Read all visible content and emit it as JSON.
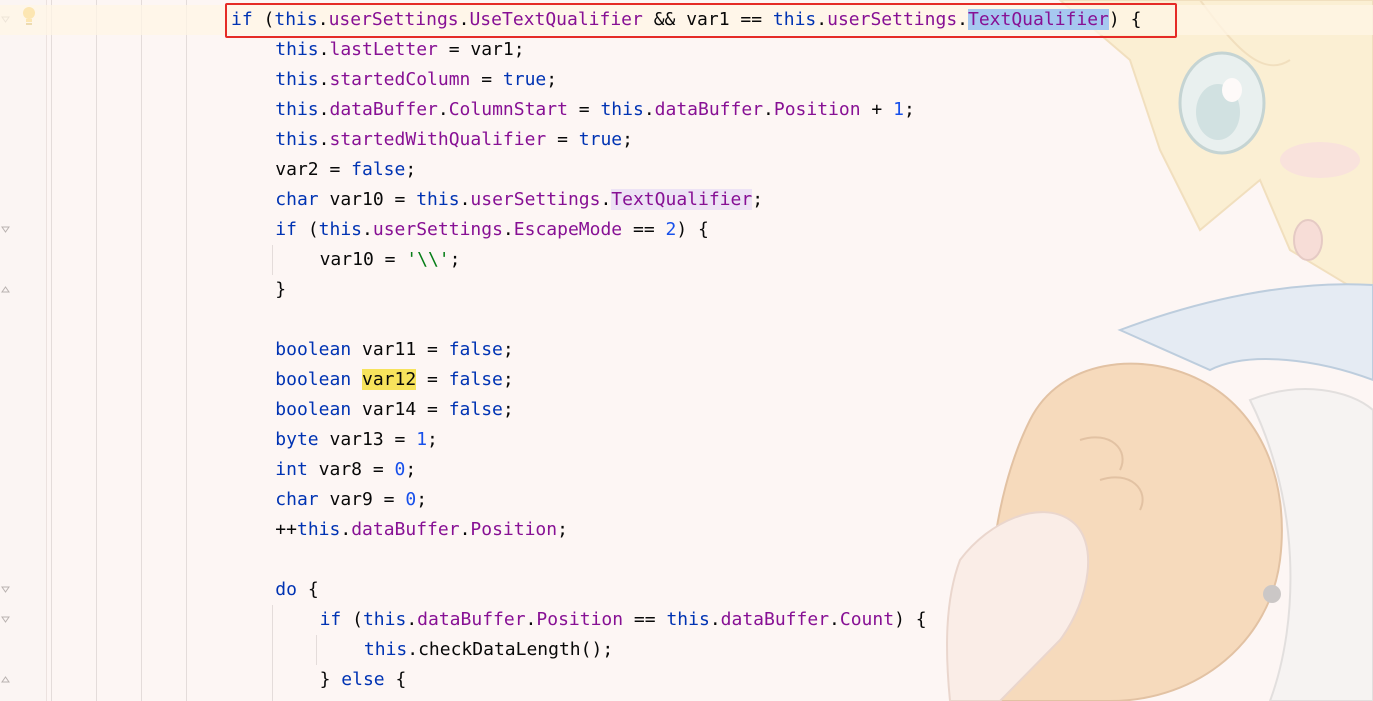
{
  "editor": {
    "accent_colors": {
      "keyword": "#0033b3",
      "field": "#871094",
      "number": "#1750eb",
      "string": "#067d17",
      "highlight_box": "#e52b26",
      "selection": "#a6c8f0",
      "identifier_highlight": "#f7e35c"
    },
    "gutter_icons": [
      "intention-bulb-icon",
      "fold-icon"
    ],
    "background_image": "anime-character-background"
  },
  "code_lines": [
    {
      "indent": 0,
      "tokens": [
        {
          "t": "if",
          "c": "kw"
        },
        {
          "t": " ("
        },
        {
          "t": "this",
          "c": "kw"
        },
        {
          "t": "."
        },
        {
          "t": "userSettings",
          "c": "fld"
        },
        {
          "t": "."
        },
        {
          "t": "UseTextQualifier",
          "c": "fld"
        },
        {
          "t": " && var1 == "
        },
        {
          "t": "this",
          "c": "kw"
        },
        {
          "t": "."
        },
        {
          "t": "userSettings",
          "c": "fld"
        },
        {
          "t": "."
        },
        {
          "t": "TextQualifier",
          "c": "fld sel-hl"
        },
        {
          "t": ") {"
        }
      ]
    },
    {
      "indent": 1,
      "tokens": [
        {
          "t": "this",
          "c": "kw"
        },
        {
          "t": "."
        },
        {
          "t": "lastLetter",
          "c": "fld"
        },
        {
          "t": " = var1;"
        }
      ]
    },
    {
      "indent": 1,
      "tokens": [
        {
          "t": "this",
          "c": "kw"
        },
        {
          "t": "."
        },
        {
          "t": "startedColumn",
          "c": "fld"
        },
        {
          "t": " = "
        },
        {
          "t": "true",
          "c": "kw"
        },
        {
          "t": ";"
        }
      ]
    },
    {
      "indent": 1,
      "tokens": [
        {
          "t": "this",
          "c": "kw"
        },
        {
          "t": "."
        },
        {
          "t": "dataBuffer",
          "c": "fld"
        },
        {
          "t": "."
        },
        {
          "t": "ColumnStart",
          "c": "fld"
        },
        {
          "t": " = "
        },
        {
          "t": "this",
          "c": "kw"
        },
        {
          "t": "."
        },
        {
          "t": "dataBuffer",
          "c": "fld"
        },
        {
          "t": "."
        },
        {
          "t": "Position",
          "c": "fld"
        },
        {
          "t": " + "
        },
        {
          "t": "1",
          "c": "num"
        },
        {
          "t": ";"
        }
      ]
    },
    {
      "indent": 1,
      "tokens": [
        {
          "t": "this",
          "c": "kw"
        },
        {
          "t": "."
        },
        {
          "t": "startedWithQualifier",
          "c": "fld"
        },
        {
          "t": " = "
        },
        {
          "t": "true",
          "c": "kw"
        },
        {
          "t": ";"
        }
      ]
    },
    {
      "indent": 1,
      "tokens": [
        {
          "t": "var2 = "
        },
        {
          "t": "false",
          "c": "kw"
        },
        {
          "t": ";"
        }
      ]
    },
    {
      "indent": 1,
      "tokens": [
        {
          "t": "char",
          "c": "kw"
        },
        {
          "t": " var10 = "
        },
        {
          "t": "this",
          "c": "kw"
        },
        {
          "t": "."
        },
        {
          "t": "userSettings",
          "c": "fld"
        },
        {
          "t": "."
        },
        {
          "t": "TextQualifier",
          "c": "fld ident-hl"
        },
        {
          "t": ";"
        }
      ]
    },
    {
      "indent": 1,
      "tokens": [
        {
          "t": "if",
          "c": "kw"
        },
        {
          "t": " ("
        },
        {
          "t": "this",
          "c": "kw"
        },
        {
          "t": "."
        },
        {
          "t": "userSettings",
          "c": "fld"
        },
        {
          "t": "."
        },
        {
          "t": "EscapeMode",
          "c": "fld"
        },
        {
          "t": " == "
        },
        {
          "t": "2",
          "c": "num"
        },
        {
          "t": ") {"
        }
      ]
    },
    {
      "indent": 2,
      "tokens": [
        {
          "t": "var10 = "
        },
        {
          "t": "'\\\\'",
          "c": "str"
        },
        {
          "t": ";"
        }
      ]
    },
    {
      "indent": 1,
      "tokens": [
        {
          "t": "}"
        }
      ]
    },
    {
      "indent": 0,
      "tokens": []
    },
    {
      "indent": 1,
      "tokens": [
        {
          "t": "boolean",
          "c": "kw"
        },
        {
          "t": " var11 = "
        },
        {
          "t": "false",
          "c": "kw"
        },
        {
          "t": ";"
        }
      ]
    },
    {
      "indent": 1,
      "tokens": [
        {
          "t": "boolean",
          "c": "kw"
        },
        {
          "t": " "
        },
        {
          "t": "var12",
          "c": "var-hl"
        },
        {
          "t": " = "
        },
        {
          "t": "false",
          "c": "kw"
        },
        {
          "t": ";"
        }
      ]
    },
    {
      "indent": 1,
      "tokens": [
        {
          "t": "boolean",
          "c": "kw"
        },
        {
          "t": " var14 = "
        },
        {
          "t": "false",
          "c": "kw"
        },
        {
          "t": ";"
        }
      ]
    },
    {
      "indent": 1,
      "tokens": [
        {
          "t": "byte",
          "c": "kw"
        },
        {
          "t": " var13 = "
        },
        {
          "t": "1",
          "c": "num"
        },
        {
          "t": ";"
        }
      ]
    },
    {
      "indent": 1,
      "tokens": [
        {
          "t": "int",
          "c": "kw"
        },
        {
          "t": " var8 = "
        },
        {
          "t": "0",
          "c": "num"
        },
        {
          "t": ";"
        }
      ]
    },
    {
      "indent": 1,
      "tokens": [
        {
          "t": "char",
          "c": "kw"
        },
        {
          "t": " var9 = "
        },
        {
          "t": "0",
          "c": "num"
        },
        {
          "t": ";"
        }
      ]
    },
    {
      "indent": 1,
      "tokens": [
        {
          "t": "++"
        },
        {
          "t": "this",
          "c": "kw"
        },
        {
          "t": "."
        },
        {
          "t": "dataBuffer",
          "c": "fld"
        },
        {
          "t": "."
        },
        {
          "t": "Position",
          "c": "fld"
        },
        {
          "t": ";"
        }
      ]
    },
    {
      "indent": 0,
      "tokens": []
    },
    {
      "indent": 1,
      "tokens": [
        {
          "t": "do",
          "c": "kw"
        },
        {
          "t": " {"
        }
      ]
    },
    {
      "indent": 2,
      "tokens": [
        {
          "t": "if",
          "c": "kw"
        },
        {
          "t": " ("
        },
        {
          "t": "this",
          "c": "kw"
        },
        {
          "t": "."
        },
        {
          "t": "dataBuffer",
          "c": "fld"
        },
        {
          "t": "."
        },
        {
          "t": "Position",
          "c": "fld"
        },
        {
          "t": " == "
        },
        {
          "t": "this",
          "c": "kw"
        },
        {
          "t": "."
        },
        {
          "t": "dataBuffer",
          "c": "fld"
        },
        {
          "t": "."
        },
        {
          "t": "Count",
          "c": "fld"
        },
        {
          "t": ") {"
        }
      ]
    },
    {
      "indent": 3,
      "tokens": [
        {
          "t": "this",
          "c": "kw"
        },
        {
          "t": ".checkDataLength();"
        }
      ]
    },
    {
      "indent": 2,
      "tokens": [
        {
          "t": "} "
        },
        {
          "t": "else",
          "c": "kw"
        },
        {
          "t": " {"
        }
      ]
    }
  ]
}
